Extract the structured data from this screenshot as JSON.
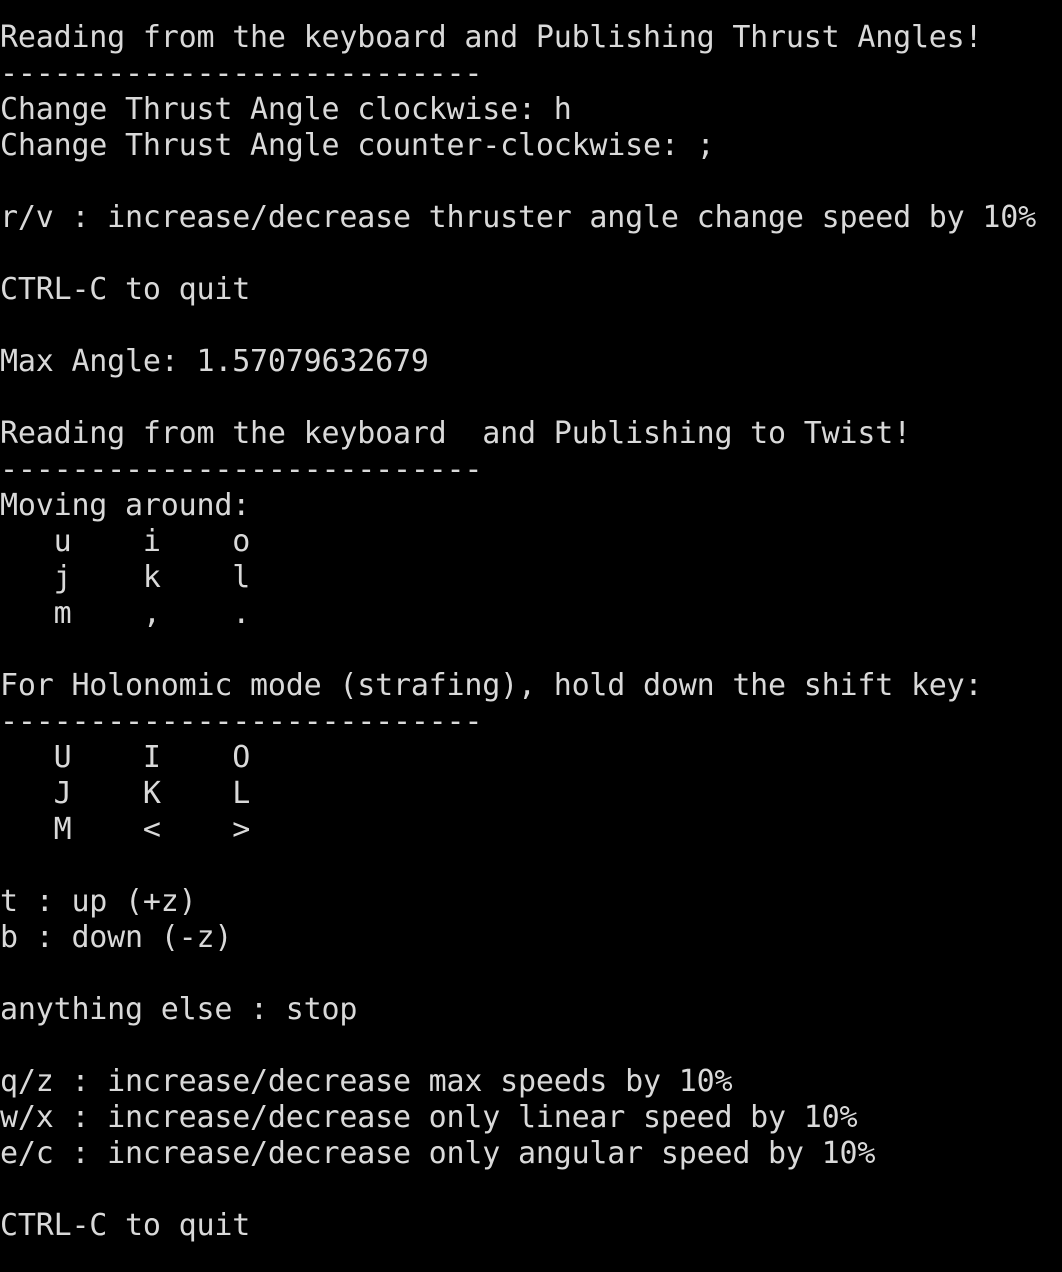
{
  "terminal": {
    "lines": [
      "Reading from the keyboard and Publishing Thrust Angles!",
      "---------------------------",
      "Change Thrust Angle clockwise: h",
      "Change Thrust Angle counter-clockwise: ;",
      "",
      "r/v : increase/decrease thruster angle change speed by 10%",
      "",
      "CTRL-C to quit",
      "",
      "Max Angle: 1.57079632679",
      "",
      "Reading from the keyboard  and Publishing to Twist!",
      "---------------------------",
      "Moving around:",
      "   u    i    o",
      "   j    k    l",
      "   m    ,    .",
      "",
      "For Holonomic mode (strafing), hold down the shift key:",
      "---------------------------",
      "   U    I    O",
      "   J    K    L",
      "   M    <    >",
      "",
      "t : up (+z)",
      "b : down (-z)",
      "",
      "anything else : stop",
      "",
      "q/z : increase/decrease max speeds by 10%",
      "w/x : increase/decrease only linear speed by 10%",
      "e/c : increase/decrease only angular speed by 10%",
      "",
      "CTRL-C to quit"
    ]
  },
  "colors": {
    "background": "#000000",
    "text": "#d9d9d9"
  }
}
